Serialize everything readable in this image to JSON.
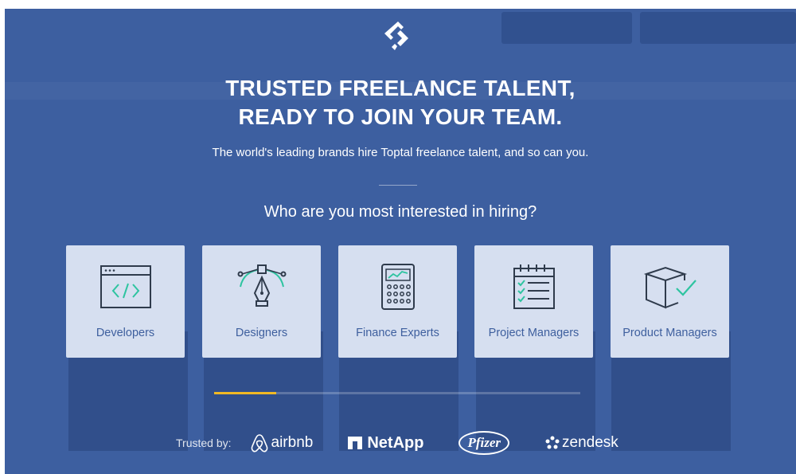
{
  "overlay": {
    "headline_line1": "TRUSTED FREELANCE TALENT,",
    "headline_line2": "READY TO JOIN YOUR TEAM.",
    "subheading": "The world's leading brands hire Toptal freelance talent, and so can you.",
    "question": "Who are you most interested in hiring?"
  },
  "categories": [
    {
      "label": "Developers",
      "icon": "code-window-icon"
    },
    {
      "label": "Designers",
      "icon": "pen-tool-icon"
    },
    {
      "label": "Finance Experts",
      "icon": "calculator-icon"
    },
    {
      "label": "Project Managers",
      "icon": "checklist-icon"
    },
    {
      "label": "Product Managers",
      "icon": "box-check-icon"
    }
  ],
  "progress": {
    "fraction": 0.17
  },
  "trusted": {
    "label": "Trusted by:",
    "brands": [
      "airbnb",
      "NetApp",
      "Pfizer",
      "zendesk"
    ]
  },
  "colors": {
    "overlay": "#3d5fa0",
    "card": "#d6dff0",
    "card_text": "#3e5f9e",
    "icon_stroke": "#2f3b4c",
    "icon_accent": "#2ec4a0",
    "progress": "#f0b825"
  }
}
